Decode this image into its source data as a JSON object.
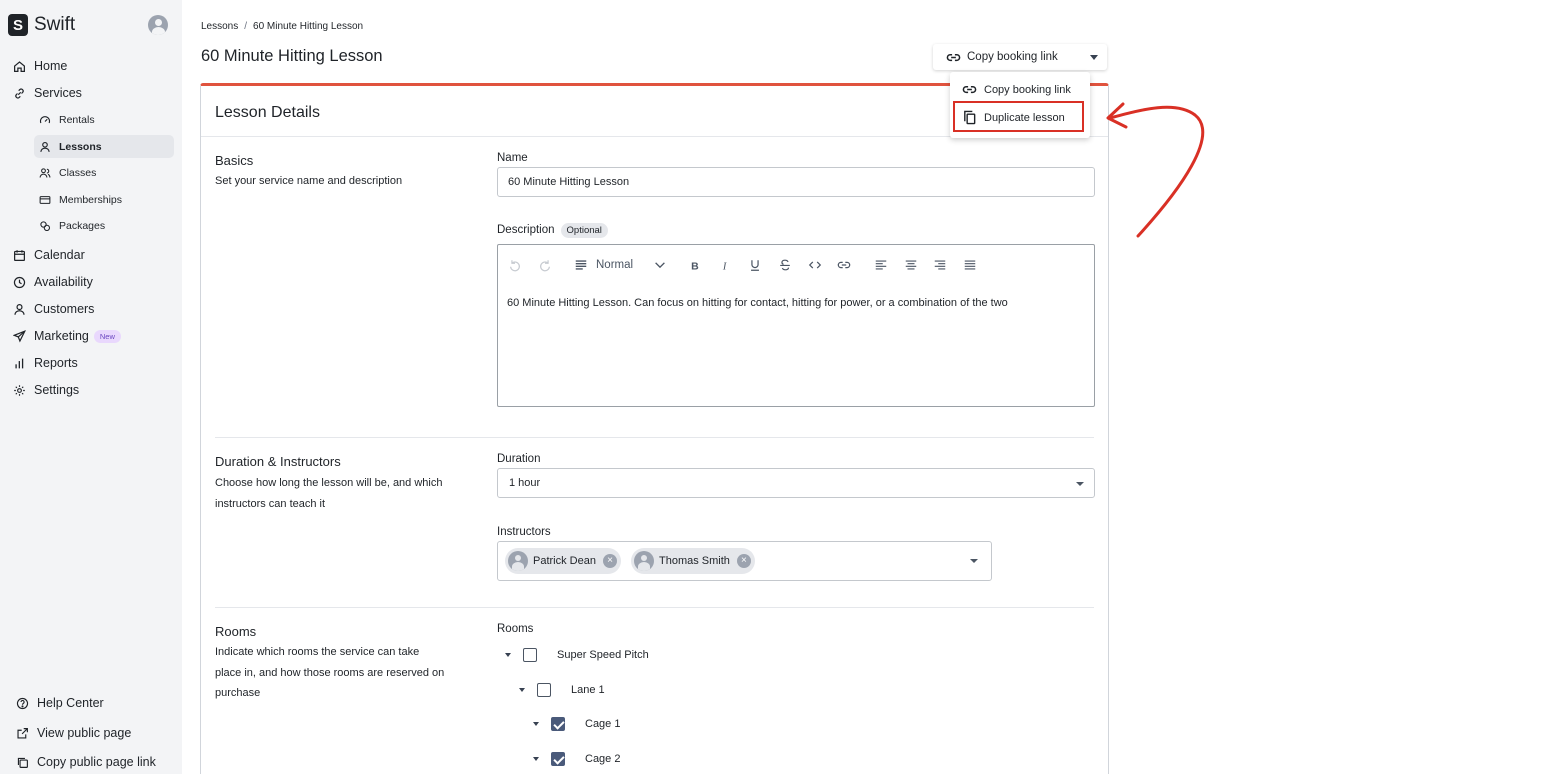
{
  "app": {
    "name": "Swift",
    "logo_letter": "S"
  },
  "sidebar": {
    "nav": [
      {
        "label": "Home",
        "icon": "home-icon"
      },
      {
        "label": "Services",
        "icon": "link-icon"
      }
    ],
    "services_sub": [
      {
        "label": "Rentals",
        "icon": "gauge-icon"
      },
      {
        "label": "Lessons",
        "icon": "person-icon"
      },
      {
        "label": "Classes",
        "icon": "people-icon"
      },
      {
        "label": "Memberships",
        "icon": "card-icon"
      },
      {
        "label": "Packages",
        "icon": "package-icon"
      }
    ],
    "nav2": [
      {
        "label": "Calendar",
        "icon": "calendar-icon"
      },
      {
        "label": "Availability",
        "icon": "clock-icon"
      },
      {
        "label": "Customers",
        "icon": "person-icon"
      },
      {
        "label": "Marketing",
        "icon": "send-icon",
        "badge": "New"
      },
      {
        "label": "Reports",
        "icon": "bar-chart-icon"
      },
      {
        "label": "Settings",
        "icon": "gear-icon"
      }
    ],
    "footer": [
      {
        "label": "Help Center",
        "icon": "help-icon"
      },
      {
        "label": "View public page",
        "icon": "external-link-icon"
      },
      {
        "label": "Copy public page link",
        "icon": "copy-icon"
      }
    ]
  },
  "breadcrumb": {
    "parent": "Lessons",
    "separator": "/",
    "current": "60 Minute Hitting Lesson"
  },
  "page": {
    "title": "60 Minute Hitting Lesson"
  },
  "actions": {
    "copy_booking_link": "Copy booking link",
    "menu": {
      "copy_booking_link": "Copy booking link",
      "duplicate_lesson": "Duplicate lesson"
    }
  },
  "card": {
    "title": "Lesson Details",
    "basics": {
      "title": "Basics",
      "description": "Set your service name and description",
      "name_label": "Name",
      "name_value": "60 Minute Hitting Lesson",
      "description_label": "Description",
      "optional": "Optional",
      "editor": {
        "block_style": "Normal",
        "text": "60 Minute Hitting Lesson. Can focus on hitting for contact, hitting for power, or a combination of the two"
      }
    },
    "duration": {
      "title": "Duration & Instructors",
      "description": "Choose how long the lesson will be, and which instructors can teach it",
      "duration_label": "Duration",
      "duration_value": "1 hour",
      "instructors_label": "Instructors",
      "instructors": [
        "Patrick Dean",
        "Thomas Smith"
      ]
    },
    "rooms": {
      "title": "Rooms",
      "description": "Indicate which rooms the service can take place in, and how those rooms are reserved on purchase",
      "rooms_label": "Rooms",
      "tree": [
        {
          "label": "Super Speed Pitch",
          "checked": false
        },
        {
          "label": "Lane 1",
          "checked": false
        },
        {
          "label": "Cage 1",
          "checked": true
        },
        {
          "label": "Cage 2",
          "checked": true
        }
      ]
    }
  },
  "colors": {
    "accent": "#e0533e",
    "annotation": "#d93025",
    "checkbox": "#4a5a7a",
    "sidebar_bg": "#f3f4f6"
  }
}
